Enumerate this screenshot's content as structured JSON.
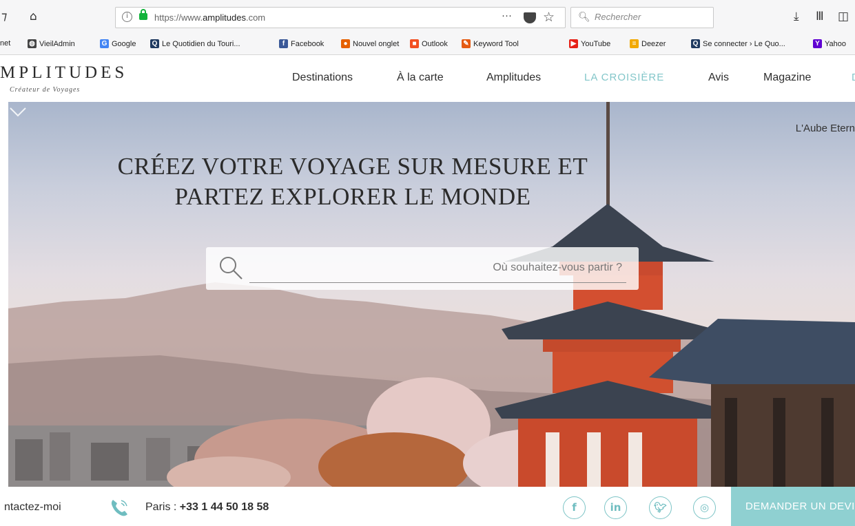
{
  "browser": {
    "url_prefix": "https://www.",
    "url_domain": "amplitudes",
    "url_suffix": ".com",
    "more_label": "···",
    "search_placeholder": "Rechercher"
  },
  "bookmarks": [
    {
      "label": "net",
      "icon": "partial-icon",
      "color": "#999999"
    },
    {
      "label": "VieilAdmin",
      "icon": "globe-icon",
      "color": "#444444"
    },
    {
      "label": "Google",
      "icon": "google-icon",
      "color": "#4285f4"
    },
    {
      "label": "Le Quotidien du Touri...",
      "icon": "q-icon",
      "color": "#1f3a60"
    },
    {
      "label": "Facebook",
      "icon": "facebook-icon",
      "color": "#3b5998"
    },
    {
      "label": "Nouvel onglet",
      "icon": "firefox-icon",
      "color": "#e66000"
    },
    {
      "label": "Outlook",
      "icon": "windows-icon",
      "color": "#f25022"
    },
    {
      "label": "Keyword Tool",
      "icon": "keyword-icon",
      "color": "#e55b13"
    },
    {
      "label": "YouTube",
      "icon": "youtube-icon",
      "color": "#e62117"
    },
    {
      "label": "Deezer",
      "icon": "deezer-icon",
      "color": "#f2a900"
    },
    {
      "label": "Se connecter › Le Quo...",
      "icon": "q-icon",
      "color": "#1f3a60"
    },
    {
      "label": "Yahoo",
      "icon": "yahoo-icon",
      "color": "#6001d2"
    }
  ],
  "header": {
    "logo": "MPLITUDES",
    "tagline": "Créateur de Voyages",
    "nav": [
      "Destinations",
      "À la carte",
      "Amplitudes",
      "LA CROISIÈRE",
      "Avis",
      "Magazine",
      "D"
    ]
  },
  "hero": {
    "corner_text": "L'Aube Etern",
    "title_line1": "CRÉEZ VOTRE VOYAGE SUR MESURE ET",
    "title_line2": "PARTEZ EXPLORER LE MONDE",
    "search_placeholder": "Où souhaitez-vous partir ?"
  },
  "footer": {
    "contact_label": "ntactez-moi",
    "phone_city": "Paris :",
    "phone_number": "+33 1 44 50 18 58",
    "social": [
      "f",
      "in",
      "t",
      "ig"
    ],
    "cta_label": "DEMANDER UN DEVIS"
  },
  "colors": {
    "accent": "#82c6c9",
    "cta_bg": "#8fd0d1",
    "lock_green": "#12b33b"
  }
}
